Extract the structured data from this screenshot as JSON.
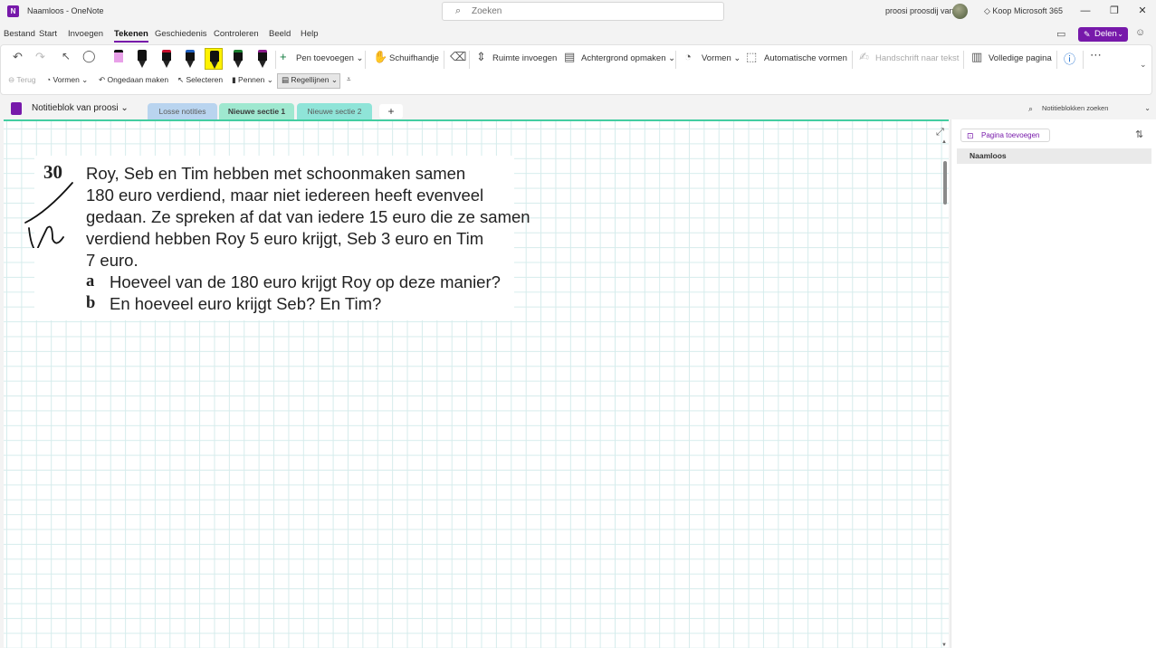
{
  "titlebar": {
    "app_logo": "N",
    "doc_title": "Naamloos  -  OneNote",
    "search_placeholder": "Zoeken",
    "user_name": "proosi proosdij van",
    "buy_label": "Koop Microsoft 365"
  },
  "menu": {
    "items": [
      "Bestand",
      "Start",
      "Invoegen",
      "Tekenen",
      "Geschiedenis",
      "Controleren",
      "Beeld",
      "Help"
    ],
    "active": "Tekenen",
    "share_label": "Delen"
  },
  "ribbon": {
    "add_pen": "Pen toevoegen",
    "hand": "Schuifhandje",
    "insert_space": "Ruimte invoegen",
    "format_background": "Achtergrond opmaken",
    "shapes": "Vormen",
    "auto_shapes": "Automatische vormen",
    "ink_to_text": "Handschrift naar tekst",
    "full_page": "Volledige pagina",
    "row2": {
      "back": "Terug",
      "shapes": "Vormen",
      "undo": "Ongedaan maken",
      "select": "Selecteren",
      "pens": "Pennen",
      "rule_lines": "Regellijnen"
    },
    "pens": [
      {
        "color": "#e8a0e8",
        "kind": "highlighter"
      },
      {
        "color": "#111111",
        "kind": "pen"
      },
      {
        "color": "#c8102e",
        "kind": "pen"
      },
      {
        "color": "#1f5fbf",
        "kind": "pen"
      },
      {
        "color": "#111111",
        "kind": "pen",
        "selected": true
      },
      {
        "color": "#1a7f2e",
        "kind": "pen"
      },
      {
        "color": "#8a1a8a",
        "kind": "pen"
      }
    ]
  },
  "sections": {
    "notebook_name": "Notitieblok van proosi",
    "tabs": [
      {
        "label": "Losse notities",
        "color": "#b9d4ef"
      },
      {
        "label": "Nieuwe sectie 1",
        "color": "#9fe8d0",
        "active": true
      },
      {
        "label": "Nieuwe sectie 2",
        "color": "#8fe4d8"
      }
    ],
    "add_tab": "+",
    "notebook_search": "Notitieblokken zoeken"
  },
  "exercise": {
    "number": "30",
    "lines": [
      "Roy, Seb en Tim hebben met schoonmaken samen",
      "180 euro verdiend, maar niet iedereen heeft evenveel",
      "gedaan. Ze spreken af dat van iedere 15 euro die ze samen",
      "verdiend hebben Roy 5 euro krijgt, Seb 3 euro en Tim",
      "7 euro."
    ],
    "questions": [
      {
        "letter": "a",
        "text": "Hoeveel van de 180 euro krijgt Roy op deze manier?"
      },
      {
        "letter": "b",
        "text": "En hoeveel euro krijgt Seb? En Tim?"
      }
    ]
  },
  "pages_pane": {
    "add_page": "Pagina toevoegen",
    "pages": [
      "Naamloos"
    ]
  }
}
